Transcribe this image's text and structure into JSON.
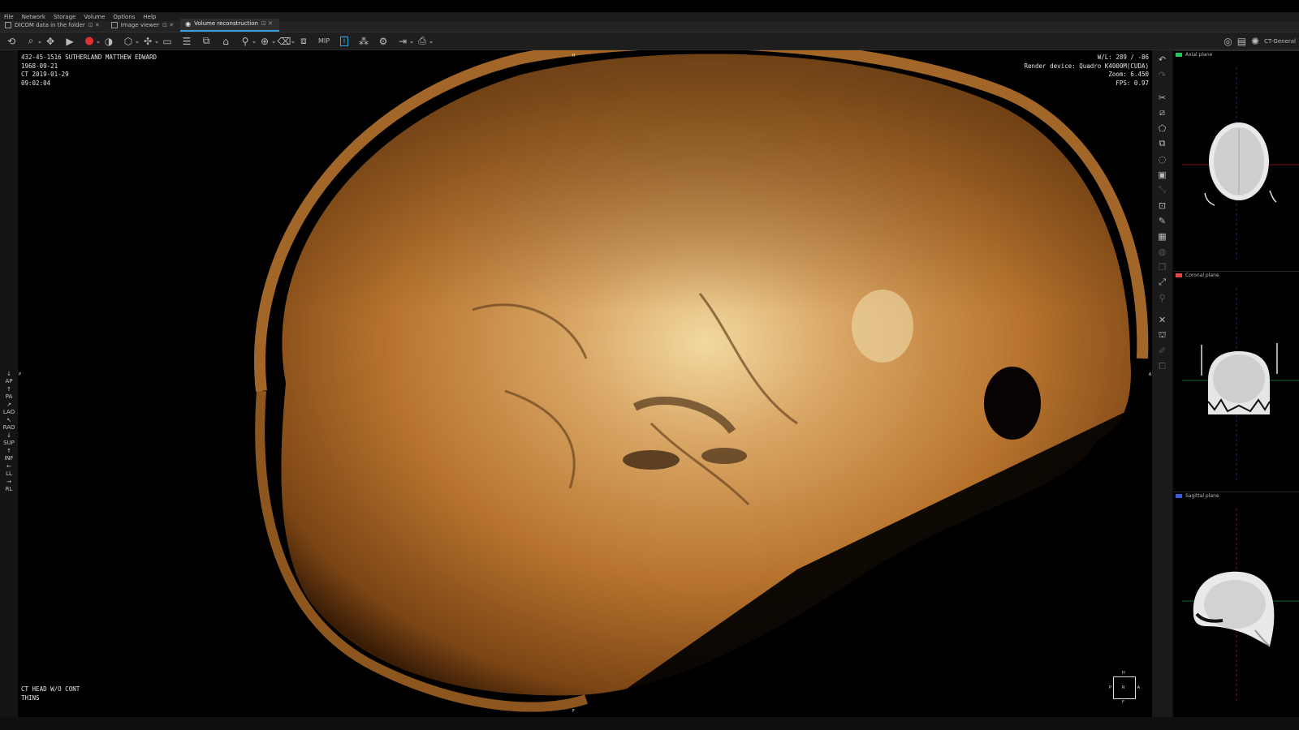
{
  "menu": [
    "File",
    "Network",
    "Storage",
    "Volume",
    "Options",
    "Help"
  ],
  "tabs": [
    {
      "label": "DICOM data in the folder",
      "active": false
    },
    {
      "label": "Image viewer",
      "active": false
    },
    {
      "label": "Volume reconstruction",
      "active": true
    }
  ],
  "toolbar": {
    "mip_label": "MIP",
    "preset": "CT-General",
    "icons": [
      "rotate-icon",
      "zoom-icon",
      "pan-icon",
      "play-icon",
      "record-icon",
      "contrast-icon",
      "cube-icon",
      "move-icon",
      "ruler-icon",
      "layers-icon",
      "cut-icon",
      "tag-icon",
      "pin-icon",
      "crosshair-icon",
      "eraser-icon",
      "window-icon",
      "info-icon",
      "sculpt-icon",
      "settings-icon",
      "export-icon",
      "print-icon"
    ]
  },
  "patient": {
    "line1": "432-45-1516 SUTHERLAND MATTHEW EDWARD",
    "dob": "1968-09-21",
    "study": "CT 2019-01-29",
    "time": "09:02:04"
  },
  "render_info": {
    "wl": "W/L: 289 / -86",
    "device": "Render device: Quadro K4000M(CUDA)",
    "zoom": "Zoom: 6.450",
    "fps": "FPS: 0.97"
  },
  "series": {
    "line1": "CT HEAD W/O CONT",
    "line2": "THINS"
  },
  "orientation": [
    "AP",
    "PA",
    "LAO",
    "RAO",
    "SUP",
    "INF",
    "LL",
    "RL"
  ],
  "cube_labels": {
    "top": "H",
    "bottom": "F",
    "left": "P",
    "right": "A",
    "center": "R"
  },
  "planes": [
    {
      "label": "Axial plane",
      "color": "#22c55e"
    },
    {
      "label": "Coronal plane",
      "color": "#ef4444"
    },
    {
      "label": "Sagittal plane",
      "color": "#3b5bdb"
    }
  ],
  "viewport_markers": {
    "top": "H",
    "bottom": "F",
    "left": "P",
    "right": "A"
  }
}
